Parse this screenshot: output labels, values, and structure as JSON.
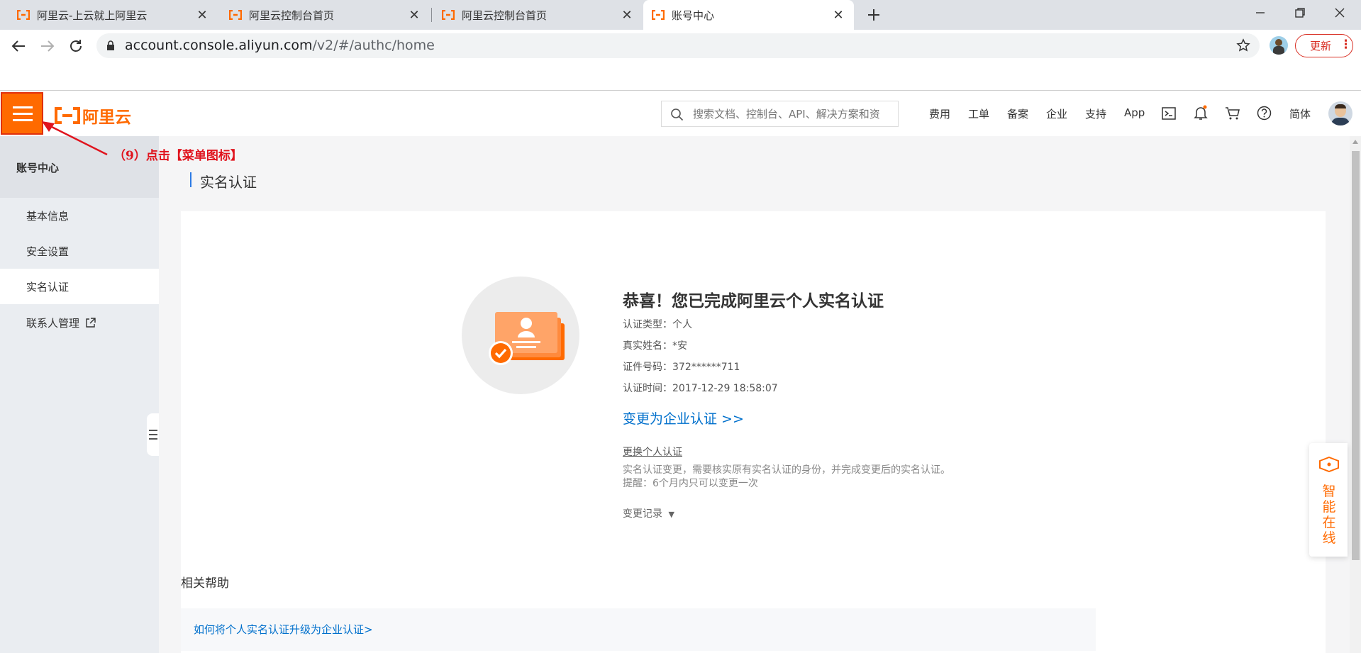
{
  "browser": {
    "tabs": [
      {
        "label": "阿里云-上云就上阿里云",
        "active": false
      },
      {
        "label": "阿里云控制台首页",
        "active": false
      },
      {
        "label": "阿里云控制台首页",
        "active": false
      },
      {
        "label": "账号中心",
        "active": true
      }
    ],
    "url_host": "account.console.aliyun.com",
    "url_path": "/v2/#/authc/home",
    "update_label": "更新"
  },
  "header": {
    "logo_text": "阿里云",
    "search_placeholder": "搜索文档、控制台、API、解决方案和资",
    "nav": [
      "费用",
      "工单",
      "备案",
      "企业",
      "支持",
      "App"
    ],
    "lang": "简体"
  },
  "sidebar": {
    "title": "账号中心",
    "items": [
      {
        "label": "基本信息",
        "active": false
      },
      {
        "label": "安全设置",
        "active": false
      },
      {
        "label": "实名认证",
        "active": true
      },
      {
        "label": "联系人管理",
        "active": false
      }
    ]
  },
  "main": {
    "section_title": "实名认证",
    "success_title": "恭喜！您已完成阿里云个人实名认证",
    "info": [
      "认证类型：个人",
      "真实姓名：*安",
      "证件号码：372******711",
      "认证时间：2017-12-29 18:58:07"
    ],
    "switch_link": "变更为企业认证 >>",
    "change_personal": "更换个人认证",
    "notes": [
      "实名认证变更，需要核实原有实名认证的身份，并完成变更后的实名认证。",
      "提醒：6个月内只可以变更一次"
    ],
    "record_label": "变更记录",
    "help_title": "相关帮助",
    "help_link": "如何将个人实名认证升级为企业认证>"
  },
  "assistant": {
    "label": "智能在线"
  },
  "annotation": {
    "text": "（9）点击【菜单图标】"
  },
  "colors": {
    "brand": "#ff6a00",
    "link": "#0070cc",
    "annotation": "#e0141e"
  }
}
